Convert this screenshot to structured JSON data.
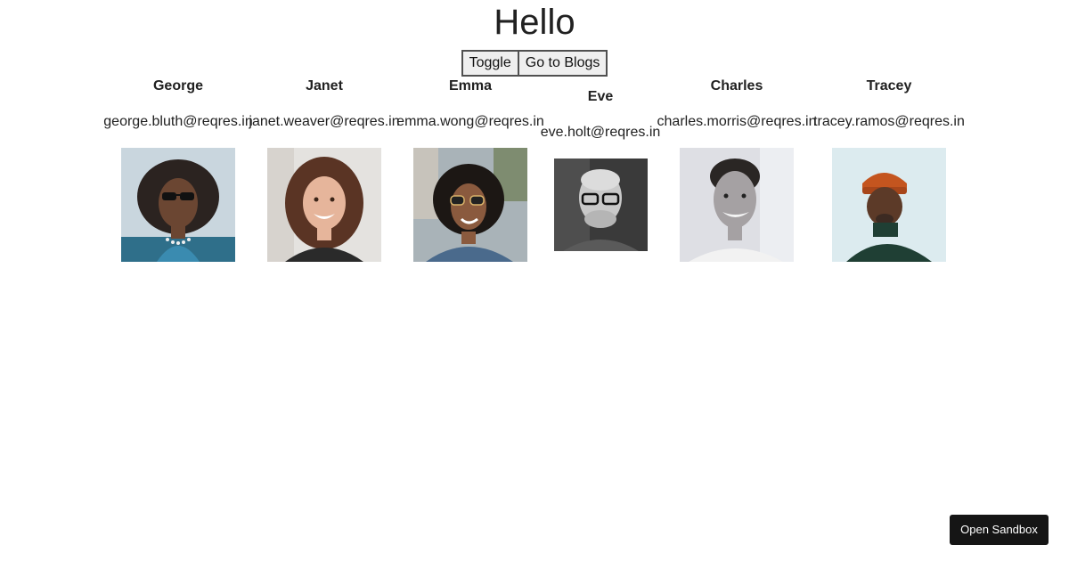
{
  "header": {
    "title": "Hello"
  },
  "toolbar": {
    "toggle_label": "Toggle",
    "blogs_label": "Go to Blogs"
  },
  "users": [
    {
      "name": "George",
      "email": "george.bluth@reqres.in",
      "avatar": "george-avatar"
    },
    {
      "name": "Janet",
      "email": "janet.weaver@reqres.in",
      "avatar": "janet-avatar"
    },
    {
      "name": "Emma",
      "email": "emma.wong@reqres.in",
      "avatar": "emma-avatar"
    },
    {
      "name": "Eve",
      "email": "eve.holt@reqres.in",
      "avatar": "eve-avatar"
    },
    {
      "name": "Charles",
      "email": "charles.morris@reqres.in",
      "avatar": "charles-avatar"
    },
    {
      "name": "Tracey",
      "email": "tracey.ramos@reqres.in",
      "avatar": "tracey-avatar"
    }
  ],
  "footer": {
    "sandbox_label": "Open Sandbox"
  }
}
